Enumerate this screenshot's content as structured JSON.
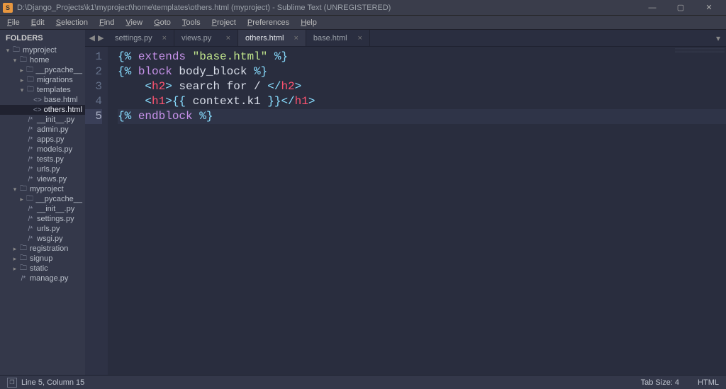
{
  "window": {
    "title": "D:\\Django_Projects\\k1\\myproject\\home\\templates\\others.html (myproject) - Sublime Text (UNREGISTERED)",
    "app_icon_letter": "S"
  },
  "menubar": [
    "File",
    "Edit",
    "Selection",
    "Find",
    "View",
    "Goto",
    "Tools",
    "Project",
    "Preferences",
    "Help"
  ],
  "sidebar": {
    "header": "FOLDERS",
    "tree": [
      {
        "d": 0,
        "tw": "▾",
        "icon": "folder",
        "label": "myproject",
        "sel": false
      },
      {
        "d": 1,
        "tw": "▾",
        "icon": "folder",
        "label": "home",
        "sel": false
      },
      {
        "d": 2,
        "tw": "▸",
        "icon": "folder",
        "label": "__pycache__",
        "sel": false
      },
      {
        "d": 2,
        "tw": "▸",
        "icon": "folder",
        "label": "migrations",
        "sel": false
      },
      {
        "d": 2,
        "tw": "▾",
        "icon": "folder",
        "label": "templates",
        "sel": false
      },
      {
        "d": 3,
        "tw": "",
        "icon": "<>",
        "label": "base.html",
        "sel": false
      },
      {
        "d": 3,
        "tw": "",
        "icon": "<>",
        "label": "others.html",
        "sel": true
      },
      {
        "d": 2,
        "tw": "",
        "icon": "/*",
        "label": "__init__.py",
        "sel": false
      },
      {
        "d": 2,
        "tw": "",
        "icon": "/*",
        "label": "admin.py",
        "sel": false
      },
      {
        "d": 2,
        "tw": "",
        "icon": "/*",
        "label": "apps.py",
        "sel": false
      },
      {
        "d": 2,
        "tw": "",
        "icon": "/*",
        "label": "models.py",
        "sel": false
      },
      {
        "d": 2,
        "tw": "",
        "icon": "/*",
        "label": "tests.py",
        "sel": false
      },
      {
        "d": 2,
        "tw": "",
        "icon": "/*",
        "label": "urls.py",
        "sel": false
      },
      {
        "d": 2,
        "tw": "",
        "icon": "/*",
        "label": "views.py",
        "sel": false
      },
      {
        "d": 1,
        "tw": "▾",
        "icon": "folder",
        "label": "myproject",
        "sel": false
      },
      {
        "d": 2,
        "tw": "▸",
        "icon": "folder",
        "label": "__pycache__",
        "sel": false
      },
      {
        "d": 2,
        "tw": "",
        "icon": "/*",
        "label": "__init__.py",
        "sel": false
      },
      {
        "d": 2,
        "tw": "",
        "icon": "/*",
        "label": "settings.py",
        "sel": false
      },
      {
        "d": 2,
        "tw": "",
        "icon": "/*",
        "label": "urls.py",
        "sel": false
      },
      {
        "d": 2,
        "tw": "",
        "icon": "/*",
        "label": "wsgi.py",
        "sel": false
      },
      {
        "d": 1,
        "tw": "▸",
        "icon": "folder",
        "label": "registration",
        "sel": false
      },
      {
        "d": 1,
        "tw": "▸",
        "icon": "folder",
        "label": "signup",
        "sel": false
      },
      {
        "d": 1,
        "tw": "▸",
        "icon": "folder",
        "label": "static",
        "sel": false
      },
      {
        "d": 1,
        "tw": "",
        "icon": "/*",
        "label": "manage.py",
        "sel": false
      }
    ]
  },
  "tabs": [
    {
      "label": "settings.py",
      "active": false
    },
    {
      "label": "views.py",
      "active": false
    },
    {
      "label": "others.html",
      "active": true
    },
    {
      "label": "base.html",
      "active": false
    }
  ],
  "editor": {
    "current_line": 5,
    "lines": [
      [
        {
          "t": "{%",
          "c": "brace"
        },
        {
          "t": " ",
          "c": "text"
        },
        {
          "t": "extends",
          "c": "kw"
        },
        {
          "t": " ",
          "c": "text"
        },
        {
          "t": "\"base.html\"",
          "c": "str"
        },
        {
          "t": " ",
          "c": "text"
        },
        {
          "t": "%}",
          "c": "brace"
        }
      ],
      [
        {
          "t": "{%",
          "c": "brace"
        },
        {
          "t": " ",
          "c": "text"
        },
        {
          "t": "block",
          "c": "kw"
        },
        {
          "t": " body_block ",
          "c": "text"
        },
        {
          "t": "%}",
          "c": "brace"
        }
      ],
      [
        {
          "t": "    ",
          "c": "text"
        },
        {
          "t": "<",
          "c": "punct"
        },
        {
          "t": "h2",
          "c": "tag"
        },
        {
          "t": ">",
          "c": "punct"
        },
        {
          "t": " search for / ",
          "c": "text"
        },
        {
          "t": "</",
          "c": "punct"
        },
        {
          "t": "h2",
          "c": "tag"
        },
        {
          "t": ">",
          "c": "punct"
        }
      ],
      [
        {
          "t": "    ",
          "c": "text"
        },
        {
          "t": "<",
          "c": "punct"
        },
        {
          "t": "h1",
          "c": "tag"
        },
        {
          "t": ">",
          "c": "punct"
        },
        {
          "t": "{{",
          "c": "brace"
        },
        {
          "t": " context.k1 ",
          "c": "var"
        },
        {
          "t": "}}",
          "c": "brace"
        },
        {
          "t": "</",
          "c": "punct"
        },
        {
          "t": "h1",
          "c": "tag"
        },
        {
          "t": ">",
          "c": "punct"
        }
      ],
      [
        {
          "t": "{%",
          "c": "brace"
        },
        {
          "t": " ",
          "c": "text"
        },
        {
          "t": "endblock",
          "c": "kw"
        },
        {
          "t": " ",
          "c": "text"
        },
        {
          "t": "%}",
          "c": "brace"
        }
      ]
    ]
  },
  "statusbar": {
    "left": "Line 5, Column 15",
    "tab_size": "Tab Size: 4",
    "syntax": "HTML"
  }
}
